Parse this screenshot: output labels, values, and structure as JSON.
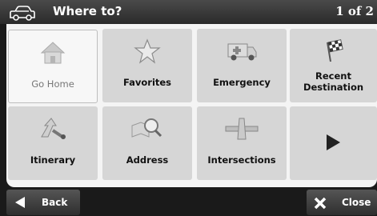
{
  "header": {
    "title": "Where to?",
    "page": "1 of 2"
  },
  "tiles": [
    {
      "label": "Go Home"
    },
    {
      "label": "Favorites"
    },
    {
      "label": "Emergency"
    },
    {
      "label": "Recent Destination"
    },
    {
      "label": "Itinerary"
    },
    {
      "label": "Address"
    },
    {
      "label": "Intersections"
    }
  ],
  "footer": {
    "back": "Back",
    "close": "Close"
  },
  "icons": {
    "header": "car-icon",
    "tiles": [
      "home-icon",
      "star-icon",
      "ambulance-icon",
      "checkered-flag-icon",
      "route-arrow-icon",
      "magnifier-map-icon",
      "intersection-icon",
      "next-arrow-icon"
    ],
    "back": "left-arrow-icon",
    "close": "x-icon"
  }
}
